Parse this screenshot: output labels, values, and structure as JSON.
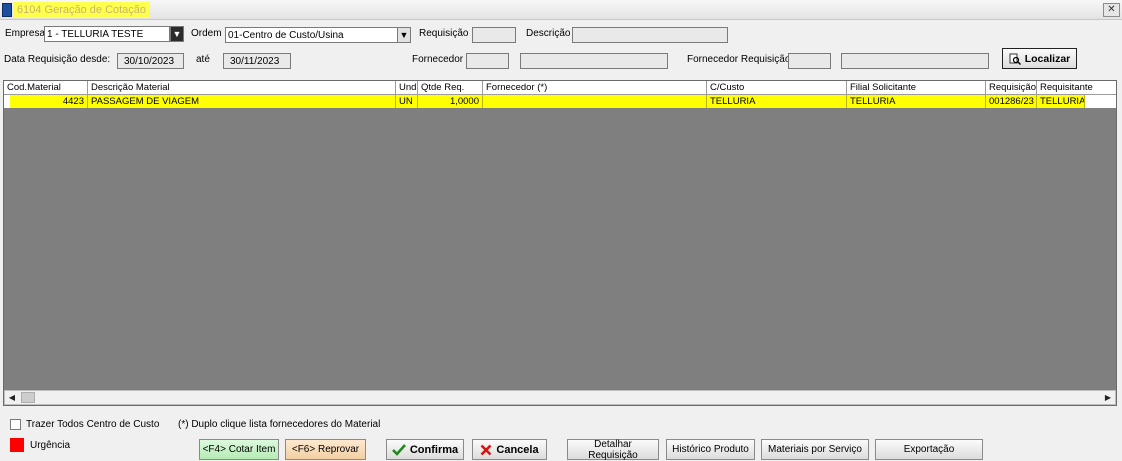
{
  "window": {
    "title": "6104 Geração de Cotação",
    "close_glyph": "✕"
  },
  "filters": {
    "empresa_label": "Empresa",
    "empresa_value": "1 - TELLURIA TESTE",
    "ordem_label": "Ordem",
    "ordem_value": "01-Centro de Custo/Usina",
    "requisicao_label": "Requisição",
    "requisicao_value": "",
    "descricao_label": "Descrição",
    "descricao_value": "",
    "data_desde_label": "Data Requisição desde:",
    "data_desde_value": "30/10/2023",
    "ate_label": "até",
    "ate_value": "30/11/2023",
    "fornecedor_label": "Fornecedor",
    "fornecedor_code": "",
    "fornecedor_name": "",
    "fornecedor_req_label": "Fornecedor Requisição",
    "fornecedor_req_code": "",
    "fornecedor_req_name": "",
    "localizar_label": "Localizar"
  },
  "grid": {
    "columns": [
      "Cod.Material",
      "Descrição Material",
      "Und",
      "Qtde Req.",
      "Fornecedor (*)",
      "C/Custo",
      "Filial Solicitante",
      "Requisição",
      "Requisitante"
    ],
    "rows": [
      {
        "cod_material": "4423",
        "descricao": "PASSAGEM DE VIAGEM",
        "und": "UN",
        "qtde": "1,0000",
        "fornecedor": "",
        "ccusto": "TELLURIA",
        "filial": "TELLURIA",
        "requisicao": "001286/23",
        "requisitante": "TELLURIA"
      }
    ],
    "scroll_left": "◀",
    "scroll_right": "▶"
  },
  "footer": {
    "trazer_todos_label": "Trazer Todos Centro de Custo",
    "nota": "(*) Duplo clique lista fornecedores do Material",
    "urgencia_label": "Urgência",
    "urgencia_color": "#ff0000",
    "cotar_label": "<F4> Cotar Item",
    "reprovar_label": "<F6> Reprovar",
    "confirma_label": "Confirma",
    "cancela_label": "Cancela",
    "detalhar_label": "Detalhar Requisição",
    "historico_label": "Histórico Produto",
    "materiais_label": "Materiais por Serviço",
    "exportacao_label": "Exportação"
  },
  "colors": {
    "highlight_row": "#ffff00",
    "grid_background": "#7f7f7f",
    "cotar_button": "#c8f5c8",
    "reprovar_button": "#f8dcb8"
  },
  "icons": {
    "app": "app-icon",
    "close": "close-icon",
    "search": "magnifier-icon",
    "confirm": "check-icon",
    "cancel": "x-icon",
    "dropdown": "dropdown-arrow-icon"
  }
}
